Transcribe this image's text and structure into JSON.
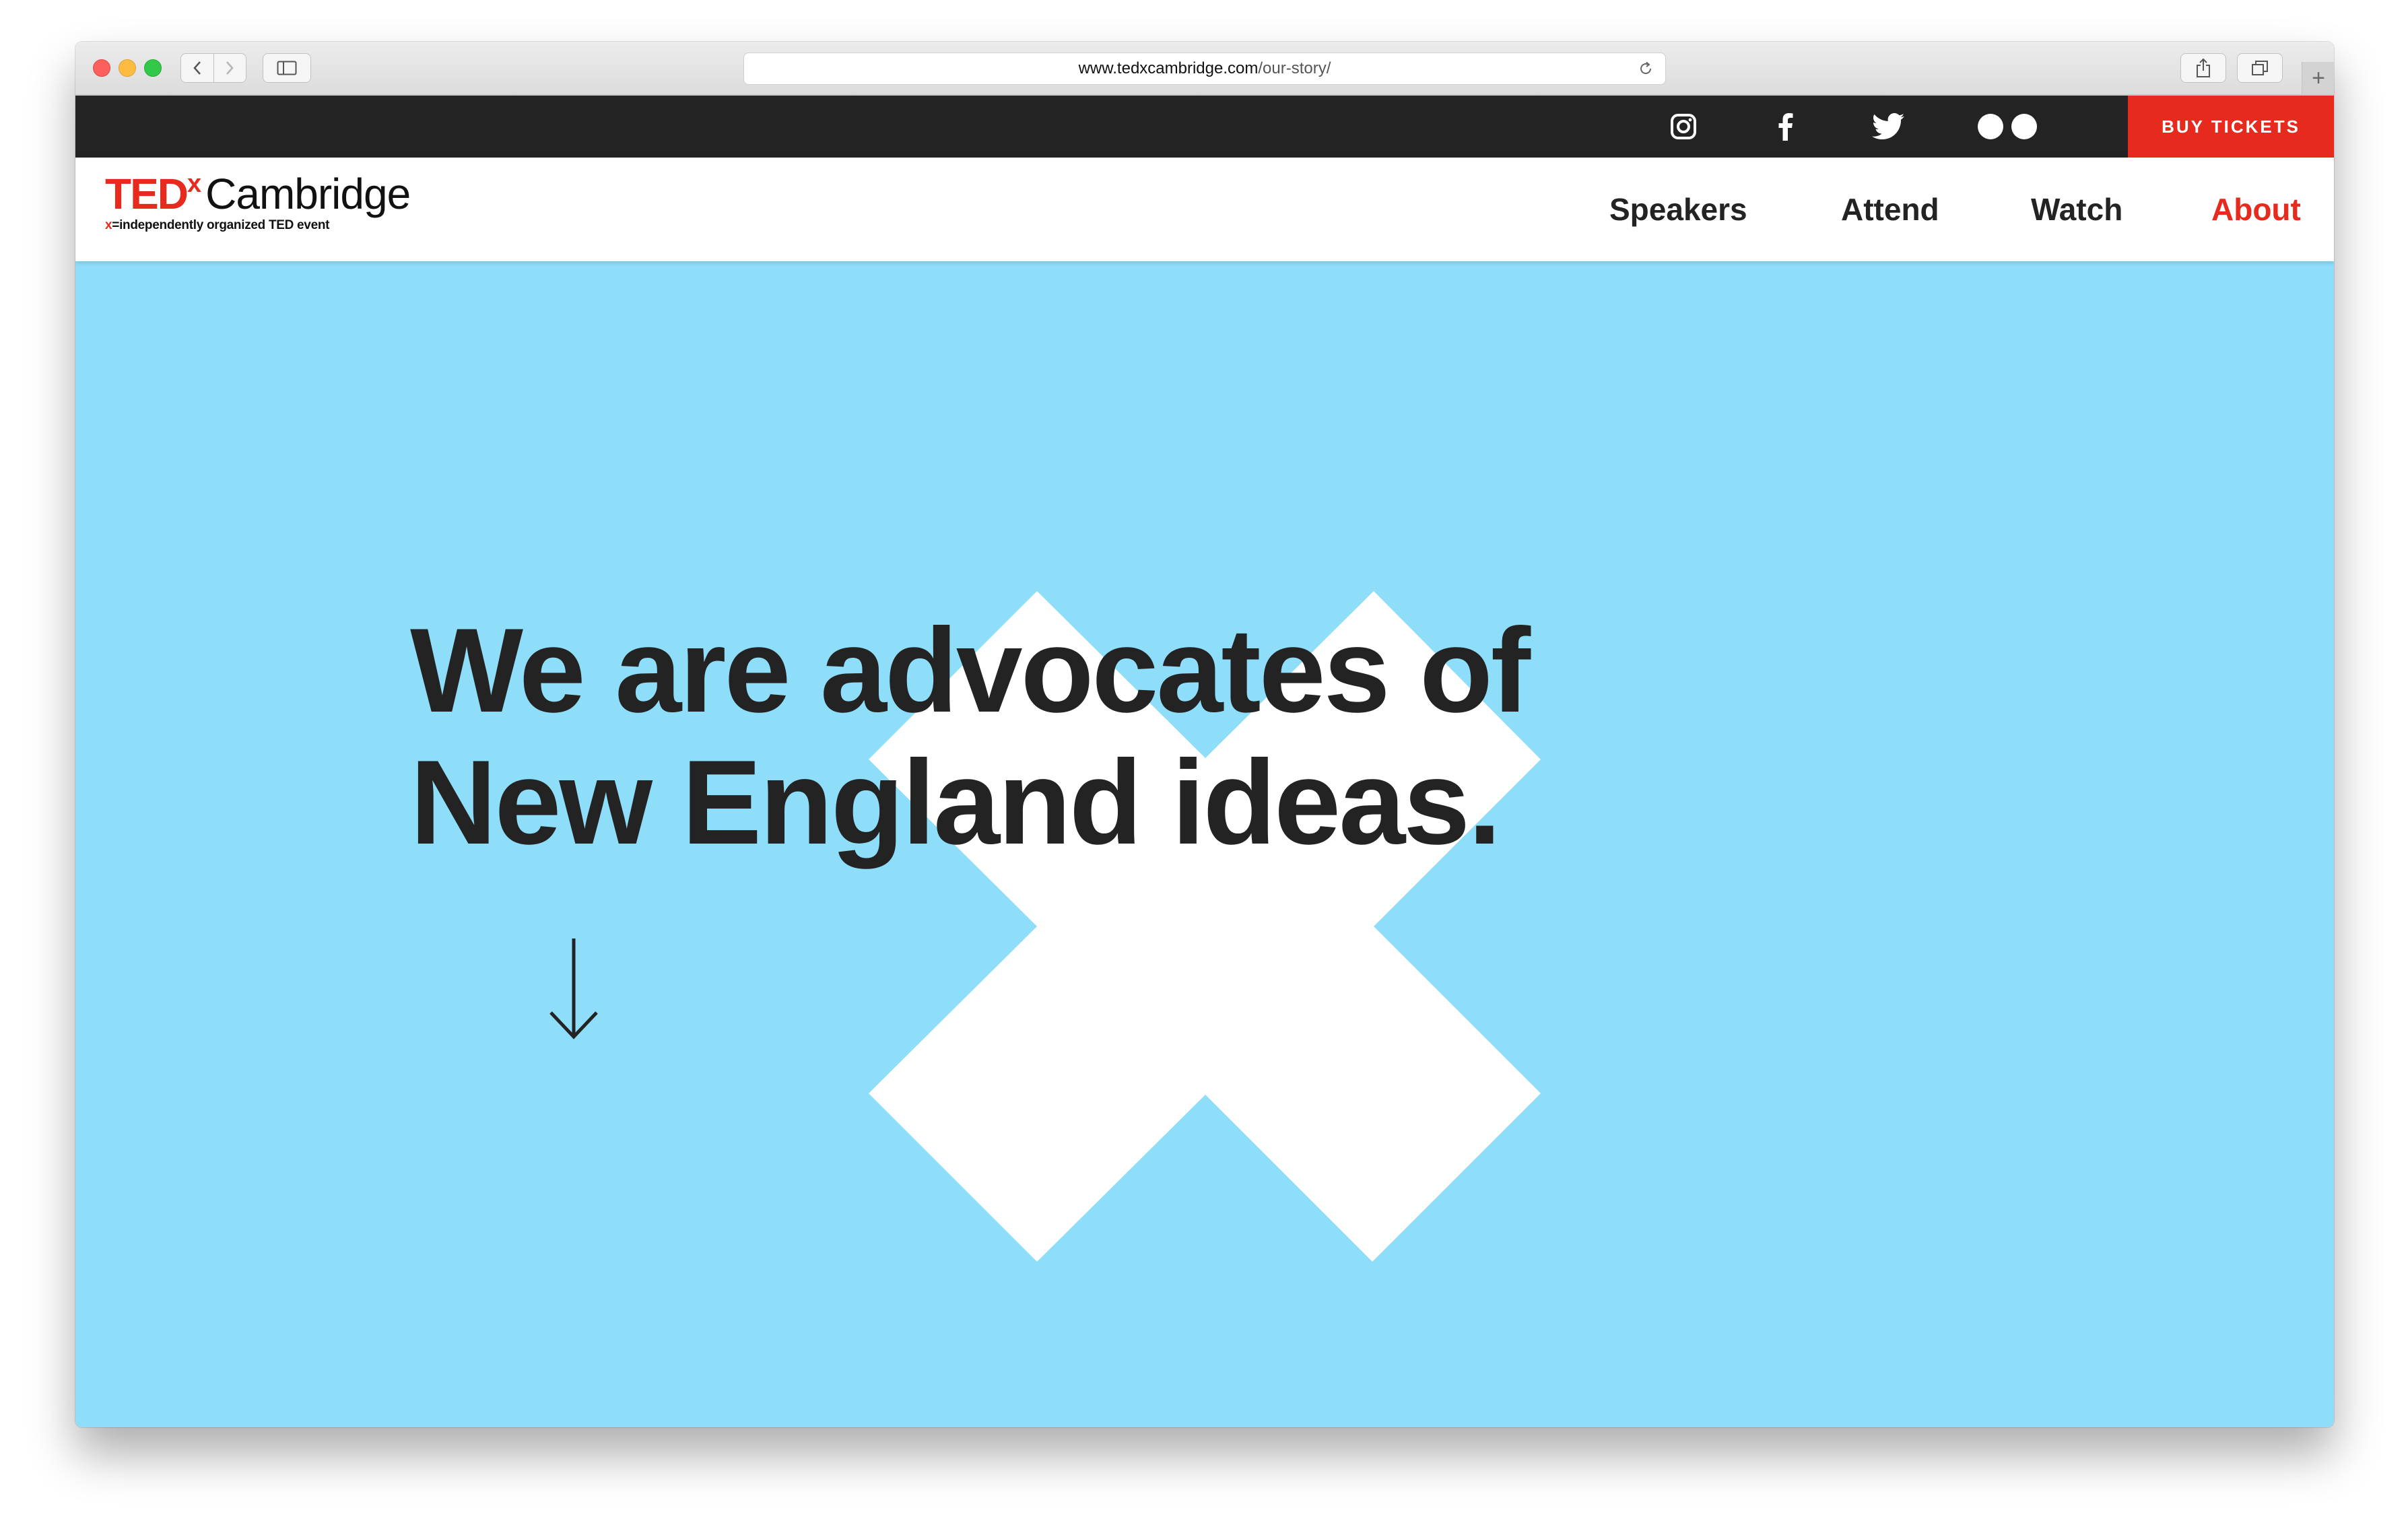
{
  "browser": {
    "url_domain": "www.tedxcambridge.com",
    "url_path": "/our-story/",
    "icons": [
      "back-icon",
      "forward-icon",
      "sidebar-icon",
      "reload-icon",
      "share-icon",
      "tabs-icon",
      "plus-icon"
    ]
  },
  "topbar": {
    "social": [
      {
        "name": "instagram",
        "icon": "instagram-icon"
      },
      {
        "name": "facebook",
        "icon": "facebook-icon"
      },
      {
        "name": "twitter",
        "icon": "twitter-icon"
      },
      {
        "name": "flickr",
        "icon": "flickr-icon"
      }
    ],
    "buy_label": "BUY TICKETS"
  },
  "logo": {
    "ted": "TED",
    "x": "x",
    "name": "Cambridge",
    "tag_x": "x",
    "tag_eq": "=",
    "tag_text": "independently organized TED event"
  },
  "nav": {
    "items": [
      {
        "label": "Speakers"
      },
      {
        "label": "Attend"
      },
      {
        "label": "Watch"
      },
      {
        "label": "About",
        "active": true
      }
    ]
  },
  "hero": {
    "line1": "We are advocates of",
    "line2": "New England ideas."
  },
  "colors": {
    "accent": "#e62b1e",
    "hero_bg": "#8edefa",
    "topbar_bg": "#232323",
    "text": "#232323"
  }
}
